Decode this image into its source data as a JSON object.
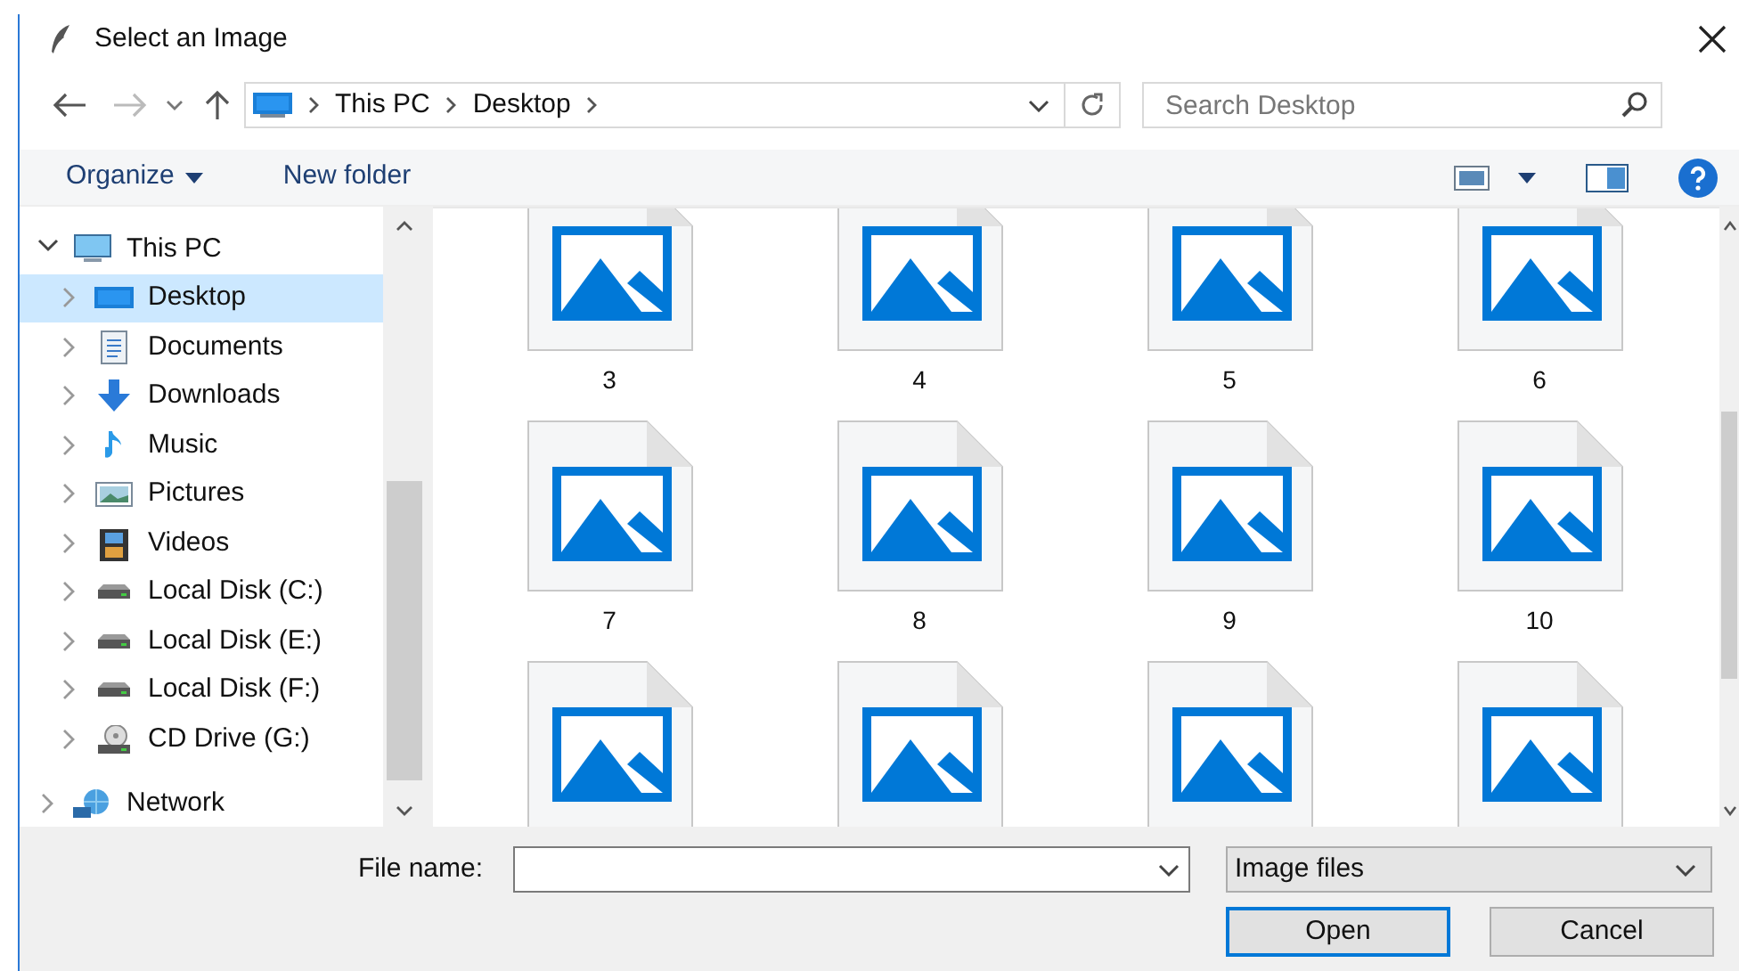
{
  "window": {
    "title": "Select an Image"
  },
  "address": {
    "path": [
      "This PC",
      "Desktop"
    ]
  },
  "search": {
    "placeholder": "Search Desktop"
  },
  "toolbar": {
    "organize": "Organize",
    "new_folder": "New folder"
  },
  "nav": [
    {
      "kind": "pc",
      "label": "This PC",
      "expanded": true,
      "selected": false,
      "children": [
        {
          "kind": "desktop",
          "label": "Desktop",
          "selected": true
        },
        {
          "kind": "documents",
          "label": "Documents",
          "selected": false
        },
        {
          "kind": "downloads",
          "label": "Downloads",
          "selected": false
        },
        {
          "kind": "music",
          "label": "Music",
          "selected": false
        },
        {
          "kind": "pictures",
          "label": "Pictures",
          "selected": false
        },
        {
          "kind": "videos",
          "label": "Videos",
          "selected": false
        },
        {
          "kind": "disk",
          "label": "Local Disk (C:)",
          "selected": false
        },
        {
          "kind": "disk",
          "label": "Local Disk (E:)",
          "selected": false
        },
        {
          "kind": "disk",
          "label": "Local Disk (F:)",
          "selected": false
        },
        {
          "kind": "cd",
          "label": "CD Drive (G:)",
          "selected": false
        }
      ]
    },
    {
      "kind": "network",
      "label": "Network",
      "expanded": false,
      "selected": false
    }
  ],
  "files": [
    {
      "kind": "image",
      "name": "3"
    },
    {
      "kind": "image",
      "name": "4"
    },
    {
      "kind": "image",
      "name": "5"
    },
    {
      "kind": "image",
      "name": "6"
    },
    {
      "kind": "image",
      "name": "7"
    },
    {
      "kind": "image",
      "name": "8"
    },
    {
      "kind": "image",
      "name": "9"
    },
    {
      "kind": "image",
      "name": "10"
    },
    {
      "kind": "image"
    },
    {
      "kind": "image"
    },
    {
      "kind": "image"
    },
    {
      "kind": "image"
    }
  ],
  "file_name": {
    "label": "File name:"
  },
  "file_type": {
    "value": "Image files"
  },
  "buttons": [
    {
      "label": "Open",
      "default": true
    },
    {
      "label": "Cancel",
      "default": false
    }
  ]
}
